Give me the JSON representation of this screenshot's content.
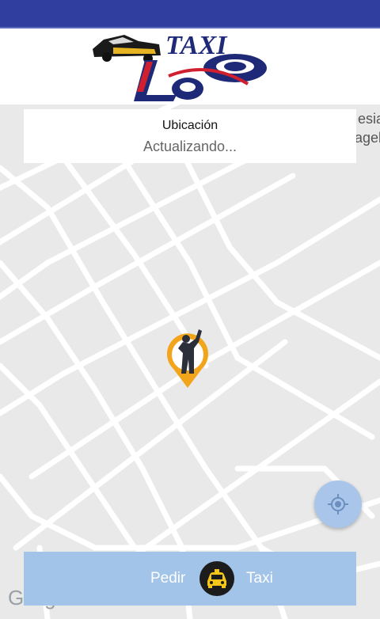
{
  "location_card": {
    "title": "Ubicación",
    "status": "Actualizando..."
  },
  "map": {
    "partial_labels": [
      "esia",
      "agel"
    ],
    "attribution": "Google"
  },
  "order_button": {
    "label_left": "Pedir",
    "label_right": "Taxi"
  },
  "colors": {
    "status_bar": "#303f9f",
    "button_bg": "#a2c4e9",
    "locate_button": "#a9c6ea",
    "pin_orange": "#f2a51a",
    "map_bg": "#e9e9e9"
  },
  "icons": {
    "logo": "taxi-leo-logo",
    "pin": "person-hailing-taxi-pin-icon",
    "locate": "my-location-icon",
    "taxi": "taxi-car-icon"
  }
}
